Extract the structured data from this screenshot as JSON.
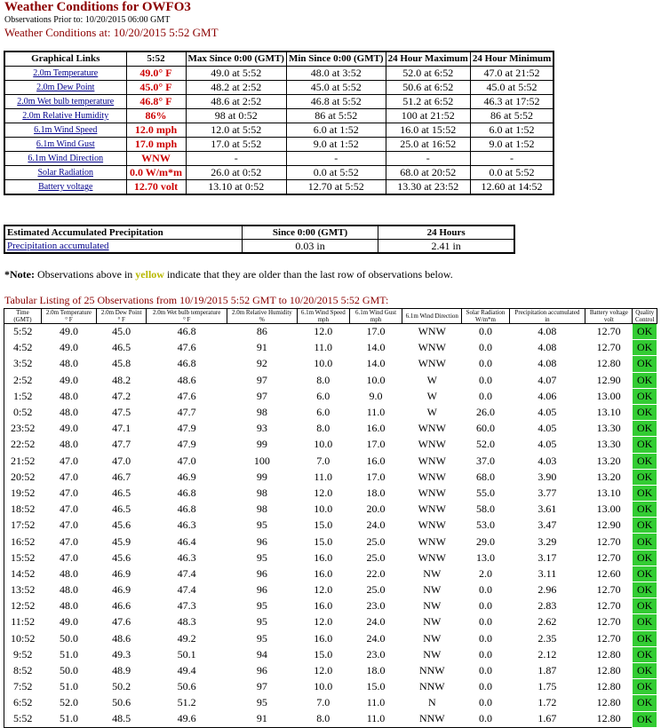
{
  "header": {
    "title": "Weather Conditions for OWFO3",
    "obs_prior": "Observations Prior to: 10/20/2015 06:00 GMT",
    "conditions_at": "Weather Conditions at: 10/20/2015 5:52 GMT"
  },
  "summary": {
    "headers": [
      "Graphical Links",
      "5:52",
      "Max Since 0:00 (GMT)",
      "Min Since 0:00 (GMT)",
      "24 Hour Maximum",
      "24 Hour Minimum"
    ],
    "rows": [
      {
        "link": "2.0m Temperature",
        "cur": "49.0° F",
        "max": "49.0 at 5:52",
        "min": "48.0 at 3:52",
        "h24max": "52.0 at 6:52",
        "h24min": "47.0 at 21:52"
      },
      {
        "link": "2.0m Dew Point",
        "cur": "45.0° F",
        "max": "48.2 at 2:52",
        "min": "45.0 at 5:52",
        "h24max": "50.6 at 6:52",
        "h24min": "45.0 at 5:52"
      },
      {
        "link": "2.0m Wet bulb temperature",
        "cur": "46.8° F",
        "max": "48.6 at 2:52",
        "min": "46.8 at 5:52",
        "h24max": "51.2 at 6:52",
        "h24min": "46.3 at 17:52"
      },
      {
        "link": "2.0m Relative Humidity",
        "cur": "86%",
        "max": "98 at 0:52",
        "min": "86 at 5:52",
        "h24max": "100 at 21:52",
        "h24min": "86 at 5:52"
      },
      {
        "link": "6.1m Wind Speed",
        "cur": "12.0 mph",
        "max": "12.0 at 5:52",
        "min": "6.0 at 1:52",
        "h24max": "16.0 at 15:52",
        "h24min": "6.0 at 1:52"
      },
      {
        "link": "6.1m Wind Gust",
        "cur": "17.0 mph",
        "max": "17.0 at 5:52",
        "min": "9.0 at 1:52",
        "h24max": "25.0 at 16:52",
        "h24min": "9.0 at 1:52"
      },
      {
        "link": "6.1m Wind Direction",
        "cur": "WNW",
        "max": "-",
        "min": "-",
        "h24max": "-",
        "h24min": "-"
      },
      {
        "link": "Solar Radiation",
        "cur": "0.0 W/m*m",
        "max": "26.0 at 0:52",
        "min": "0.0 at 5:52",
        "h24max": "68.0 at 20:52",
        "h24min": "0.0 at 5:52"
      },
      {
        "link": "Battery voltage",
        "cur": "12.70 volt",
        "max": "13.10 at 0:52",
        "min": "12.70 at 5:52",
        "h24max": "13.30 at 23:52",
        "h24min": "12.60 at 14:52"
      }
    ]
  },
  "precip": {
    "h1": "Estimated Accumulated Precipitation",
    "h2": "Since 0:00 (GMT)",
    "h3": "24 Hours",
    "link": "Precipitation accumulated",
    "since": "0.03  in",
    "h24": "2.41  in"
  },
  "note": {
    "label": "*Note:",
    "before": " Observations above in ",
    "yellow": "yellow",
    "after": " indicate that they are older than the last row of observations below."
  },
  "tabular": {
    "title": "Tabular Listing of 25 Observations from 10/19/2015 5:52 GMT to 10/20/2015 5:52 GMT:",
    "headers": [
      [
        "Time",
        "(GMT)"
      ],
      [
        "2.0m Temperature",
        "° F"
      ],
      [
        "2.0m Dew Point",
        "° F"
      ],
      [
        "2.0m Wet bulb temperature",
        "° F"
      ],
      [
        "2.0m Relative Humidity",
        "%"
      ],
      [
        "6.1m Wind Speed",
        "mph"
      ],
      [
        "6.1m Wind Gust",
        "mph"
      ],
      [
        "6.1m Wind Direction",
        ""
      ],
      [
        "Solar Radiation",
        "W/m*m"
      ],
      [
        "Precipitation accumulated",
        "in"
      ],
      [
        "Battery voltage",
        "volt"
      ],
      [
        "Quality",
        "Control"
      ]
    ],
    "rows": [
      [
        "5:52",
        "49.0",
        "45.0",
        "46.8",
        "86",
        "12.0",
        "17.0",
        "WNW",
        "0.0",
        "4.08",
        "12.70",
        "OK"
      ],
      [
        "4:52",
        "49.0",
        "46.5",
        "47.6",
        "91",
        "11.0",
        "14.0",
        "WNW",
        "0.0",
        "4.08",
        "12.70",
        "OK"
      ],
      [
        "3:52",
        "48.0",
        "45.8",
        "46.8",
        "92",
        "10.0",
        "14.0",
        "WNW",
        "0.0",
        "4.08",
        "12.80",
        "OK"
      ],
      [
        "2:52",
        "49.0",
        "48.2",
        "48.6",
        "97",
        "8.0",
        "10.0",
        "W",
        "0.0",
        "4.07",
        "12.90",
        "OK"
      ],
      [
        "1:52",
        "48.0",
        "47.2",
        "47.6",
        "97",
        "6.0",
        "9.0",
        "W",
        "0.0",
        "4.06",
        "13.00",
        "OK"
      ],
      [
        "0:52",
        "48.0",
        "47.5",
        "47.7",
        "98",
        "6.0",
        "11.0",
        "W",
        "26.0",
        "4.05",
        "13.10",
        "OK"
      ],
      [
        "23:52",
        "49.0",
        "47.1",
        "47.9",
        "93",
        "8.0",
        "16.0",
        "WNW",
        "60.0",
        "4.05",
        "13.30",
        "OK"
      ],
      [
        "22:52",
        "48.0",
        "47.7",
        "47.9",
        "99",
        "10.0",
        "17.0",
        "WNW",
        "52.0",
        "4.05",
        "13.30",
        "OK"
      ],
      [
        "21:52",
        "47.0",
        "47.0",
        "47.0",
        "100",
        "7.0",
        "16.0",
        "WNW",
        "37.0",
        "4.03",
        "13.20",
        "OK"
      ],
      [
        "20:52",
        "47.0",
        "46.7",
        "46.9",
        "99",
        "11.0",
        "17.0",
        "WNW",
        "68.0",
        "3.90",
        "13.20",
        "OK"
      ],
      [
        "19:52",
        "47.0",
        "46.5",
        "46.8",
        "98",
        "12.0",
        "18.0",
        "WNW",
        "55.0",
        "3.77",
        "13.10",
        "OK"
      ],
      [
        "18:52",
        "47.0",
        "46.5",
        "46.8",
        "98",
        "10.0",
        "20.0",
        "WNW",
        "58.0",
        "3.61",
        "13.00",
        "OK"
      ],
      [
        "17:52",
        "47.0",
        "45.6",
        "46.3",
        "95",
        "15.0",
        "24.0",
        "WNW",
        "53.0",
        "3.47",
        "12.90",
        "OK"
      ],
      [
        "16:52",
        "47.0",
        "45.9",
        "46.4",
        "96",
        "15.0",
        "25.0",
        "WNW",
        "29.0",
        "3.29",
        "12.70",
        "OK"
      ],
      [
        "15:52",
        "47.0",
        "45.6",
        "46.3",
        "95",
        "16.0",
        "25.0",
        "WNW",
        "13.0",
        "3.17",
        "12.70",
        "OK"
      ],
      [
        "14:52",
        "48.0",
        "46.9",
        "47.4",
        "96",
        "16.0",
        "22.0",
        "NW",
        "2.0",
        "3.11",
        "12.60",
        "OK"
      ],
      [
        "13:52",
        "48.0",
        "46.9",
        "47.4",
        "96",
        "12.0",
        "25.0",
        "NW",
        "0.0",
        "2.96",
        "12.70",
        "OK"
      ],
      [
        "12:52",
        "48.0",
        "46.6",
        "47.3",
        "95",
        "16.0",
        "23.0",
        "NW",
        "0.0",
        "2.83",
        "12.70",
        "OK"
      ],
      [
        "11:52",
        "49.0",
        "47.6",
        "48.3",
        "95",
        "12.0",
        "24.0",
        "NW",
        "0.0",
        "2.62",
        "12.70",
        "OK"
      ],
      [
        "10:52",
        "50.0",
        "48.6",
        "49.2",
        "95",
        "16.0",
        "24.0",
        "NW",
        "0.0",
        "2.35",
        "12.70",
        "OK"
      ],
      [
        "9:52",
        "51.0",
        "49.3",
        "50.1",
        "94",
        "15.0",
        "23.0",
        "NW",
        "0.0",
        "2.12",
        "12.80",
        "OK"
      ],
      [
        "8:52",
        "50.0",
        "48.9",
        "49.4",
        "96",
        "12.0",
        "18.0",
        "NNW",
        "0.0",
        "1.87",
        "12.80",
        "OK"
      ],
      [
        "7:52",
        "51.0",
        "50.2",
        "50.6",
        "97",
        "10.0",
        "15.0",
        "NNW",
        "0.0",
        "1.75",
        "12.80",
        "OK"
      ],
      [
        "6:52",
        "52.0",
        "50.6",
        "51.2",
        "95",
        "7.0",
        "11.0",
        "N",
        "0.0",
        "1.72",
        "12.80",
        "OK"
      ],
      [
        "5:52",
        "51.0",
        "48.5",
        "49.6",
        "91",
        "8.0",
        "11.0",
        "NNW",
        "0.0",
        "1.67",
        "12.80",
        "OK"
      ]
    ]
  },
  "colors": {
    "title": "#8b0000",
    "current_value": "#cc0000",
    "ok_bg": "#33cc33",
    "link": "#00008b",
    "note_highlight": "#b8b800"
  }
}
